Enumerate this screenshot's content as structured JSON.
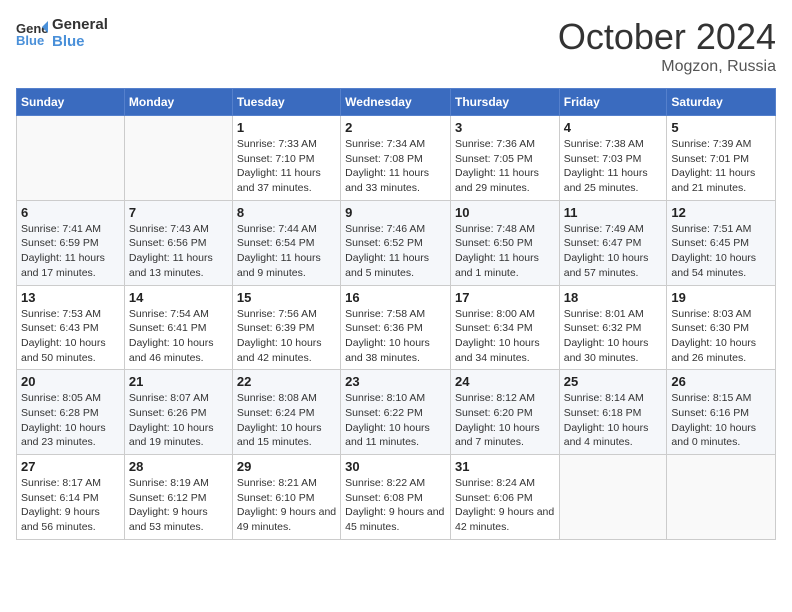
{
  "logo": {
    "line1": "General",
    "line2": "Blue"
  },
  "title": "October 2024",
  "location": "Mogzon, Russia",
  "days_of_week": [
    "Sunday",
    "Monday",
    "Tuesday",
    "Wednesday",
    "Thursday",
    "Friday",
    "Saturday"
  ],
  "weeks": [
    [
      {
        "day": "",
        "info": ""
      },
      {
        "day": "",
        "info": ""
      },
      {
        "day": "1",
        "info": "Sunrise: 7:33 AM\nSunset: 7:10 PM\nDaylight: 11 hours and 37 minutes."
      },
      {
        "day": "2",
        "info": "Sunrise: 7:34 AM\nSunset: 7:08 PM\nDaylight: 11 hours and 33 minutes."
      },
      {
        "day": "3",
        "info": "Sunrise: 7:36 AM\nSunset: 7:05 PM\nDaylight: 11 hours and 29 minutes."
      },
      {
        "day": "4",
        "info": "Sunrise: 7:38 AM\nSunset: 7:03 PM\nDaylight: 11 hours and 25 minutes."
      },
      {
        "day": "5",
        "info": "Sunrise: 7:39 AM\nSunset: 7:01 PM\nDaylight: 11 hours and 21 minutes."
      }
    ],
    [
      {
        "day": "6",
        "info": "Sunrise: 7:41 AM\nSunset: 6:59 PM\nDaylight: 11 hours and 17 minutes."
      },
      {
        "day": "7",
        "info": "Sunrise: 7:43 AM\nSunset: 6:56 PM\nDaylight: 11 hours and 13 minutes."
      },
      {
        "day": "8",
        "info": "Sunrise: 7:44 AM\nSunset: 6:54 PM\nDaylight: 11 hours and 9 minutes."
      },
      {
        "day": "9",
        "info": "Sunrise: 7:46 AM\nSunset: 6:52 PM\nDaylight: 11 hours and 5 minutes."
      },
      {
        "day": "10",
        "info": "Sunrise: 7:48 AM\nSunset: 6:50 PM\nDaylight: 11 hours and 1 minute."
      },
      {
        "day": "11",
        "info": "Sunrise: 7:49 AM\nSunset: 6:47 PM\nDaylight: 10 hours and 57 minutes."
      },
      {
        "day": "12",
        "info": "Sunrise: 7:51 AM\nSunset: 6:45 PM\nDaylight: 10 hours and 54 minutes."
      }
    ],
    [
      {
        "day": "13",
        "info": "Sunrise: 7:53 AM\nSunset: 6:43 PM\nDaylight: 10 hours and 50 minutes."
      },
      {
        "day": "14",
        "info": "Sunrise: 7:54 AM\nSunset: 6:41 PM\nDaylight: 10 hours and 46 minutes."
      },
      {
        "day": "15",
        "info": "Sunrise: 7:56 AM\nSunset: 6:39 PM\nDaylight: 10 hours and 42 minutes."
      },
      {
        "day": "16",
        "info": "Sunrise: 7:58 AM\nSunset: 6:36 PM\nDaylight: 10 hours and 38 minutes."
      },
      {
        "day": "17",
        "info": "Sunrise: 8:00 AM\nSunset: 6:34 PM\nDaylight: 10 hours and 34 minutes."
      },
      {
        "day": "18",
        "info": "Sunrise: 8:01 AM\nSunset: 6:32 PM\nDaylight: 10 hours and 30 minutes."
      },
      {
        "day": "19",
        "info": "Sunrise: 8:03 AM\nSunset: 6:30 PM\nDaylight: 10 hours and 26 minutes."
      }
    ],
    [
      {
        "day": "20",
        "info": "Sunrise: 8:05 AM\nSunset: 6:28 PM\nDaylight: 10 hours and 23 minutes."
      },
      {
        "day": "21",
        "info": "Sunrise: 8:07 AM\nSunset: 6:26 PM\nDaylight: 10 hours and 19 minutes."
      },
      {
        "day": "22",
        "info": "Sunrise: 8:08 AM\nSunset: 6:24 PM\nDaylight: 10 hours and 15 minutes."
      },
      {
        "day": "23",
        "info": "Sunrise: 8:10 AM\nSunset: 6:22 PM\nDaylight: 10 hours and 11 minutes."
      },
      {
        "day": "24",
        "info": "Sunrise: 8:12 AM\nSunset: 6:20 PM\nDaylight: 10 hours and 7 minutes."
      },
      {
        "day": "25",
        "info": "Sunrise: 8:14 AM\nSunset: 6:18 PM\nDaylight: 10 hours and 4 minutes."
      },
      {
        "day": "26",
        "info": "Sunrise: 8:15 AM\nSunset: 6:16 PM\nDaylight: 10 hours and 0 minutes."
      }
    ],
    [
      {
        "day": "27",
        "info": "Sunrise: 8:17 AM\nSunset: 6:14 PM\nDaylight: 9 hours and 56 minutes."
      },
      {
        "day": "28",
        "info": "Sunrise: 8:19 AM\nSunset: 6:12 PM\nDaylight: 9 hours and 53 minutes."
      },
      {
        "day": "29",
        "info": "Sunrise: 8:21 AM\nSunset: 6:10 PM\nDaylight: 9 hours and 49 minutes."
      },
      {
        "day": "30",
        "info": "Sunrise: 8:22 AM\nSunset: 6:08 PM\nDaylight: 9 hours and 45 minutes."
      },
      {
        "day": "31",
        "info": "Sunrise: 8:24 AM\nSunset: 6:06 PM\nDaylight: 9 hours and 42 minutes."
      },
      {
        "day": "",
        "info": ""
      },
      {
        "day": "",
        "info": ""
      }
    ]
  ]
}
